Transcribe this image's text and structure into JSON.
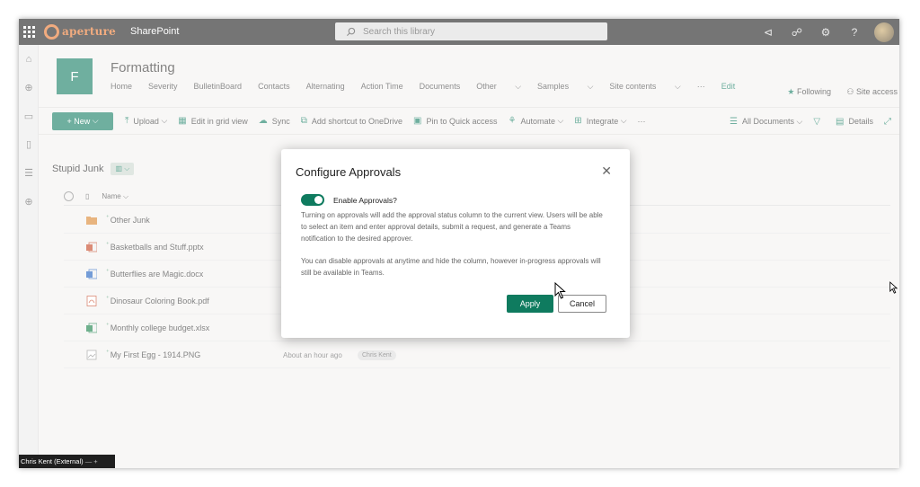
{
  "suite": {
    "logo_text": "aperture",
    "app_name": "SharePoint",
    "search_placeholder": "Search this library",
    "icons": [
      "megaphone-icon",
      "share-icon",
      "gear-icon",
      "help-icon"
    ]
  },
  "site": {
    "logo_letter": "F",
    "title": "Formatting",
    "nav": [
      "Home",
      "Severity",
      "BulletinBoard",
      "Contacts",
      "Alternating",
      "Action Time",
      "Documents",
      "Other",
      "Samples",
      "Site contents",
      "···",
      "Edit"
    ],
    "following": "Following",
    "site_access": "Site access"
  },
  "commands": {
    "new": "New",
    "upload": "Upload",
    "grid": "Edit in grid view",
    "sync": "Sync",
    "shortcut": "Add shortcut to OneDrive",
    "pin": "Pin to Quick access",
    "automate": "Automate",
    "integrate": "Integrate",
    "more": "···",
    "view": "All Documents",
    "details": "Details"
  },
  "library": {
    "title": "Stupid Junk",
    "name_column": "Name",
    "files": [
      {
        "name": "Other Junk",
        "type": "folder",
        "modified": "",
        "by": ""
      },
      {
        "name": "Basketballs and Stuff.pptx",
        "type": "pptx",
        "modified": "",
        "by": ""
      },
      {
        "name": "Butterflies are Magic.docx",
        "type": "docx",
        "modified": "",
        "by": ""
      },
      {
        "name": "Dinosaur Coloring Book.pdf",
        "type": "pdf",
        "modified": "",
        "by": ""
      },
      {
        "name": "Monthly college budget.xlsx",
        "type": "xlsx",
        "modified": "",
        "by": ""
      },
      {
        "name": "My First Egg - 1914.PNG",
        "type": "png",
        "modified": "About an hour ago",
        "by": "Chris Kent"
      }
    ]
  },
  "dialog": {
    "title": "Configure Approvals",
    "toggle_label": "Enable Approvals?",
    "toggle_on": true,
    "paragraph1": "Turning on approvals will add the approval status column to the current view. Users will be able to select an item and enter approval details, submit a request, and generate a Teams notification to the desired approver.",
    "paragraph2": "You can disable approvals at anytime and hide the column, however in-progress approvals will still be available in Teams.",
    "apply": "Apply",
    "cancel": "Cancel"
  },
  "chat": {
    "label": "Chris Kent (External)",
    "controls": "— +"
  },
  "colors": {
    "accent": "#0f7b5f",
    "suitebar": "#1a1a1a",
    "brand_orange": "#e8742a"
  }
}
